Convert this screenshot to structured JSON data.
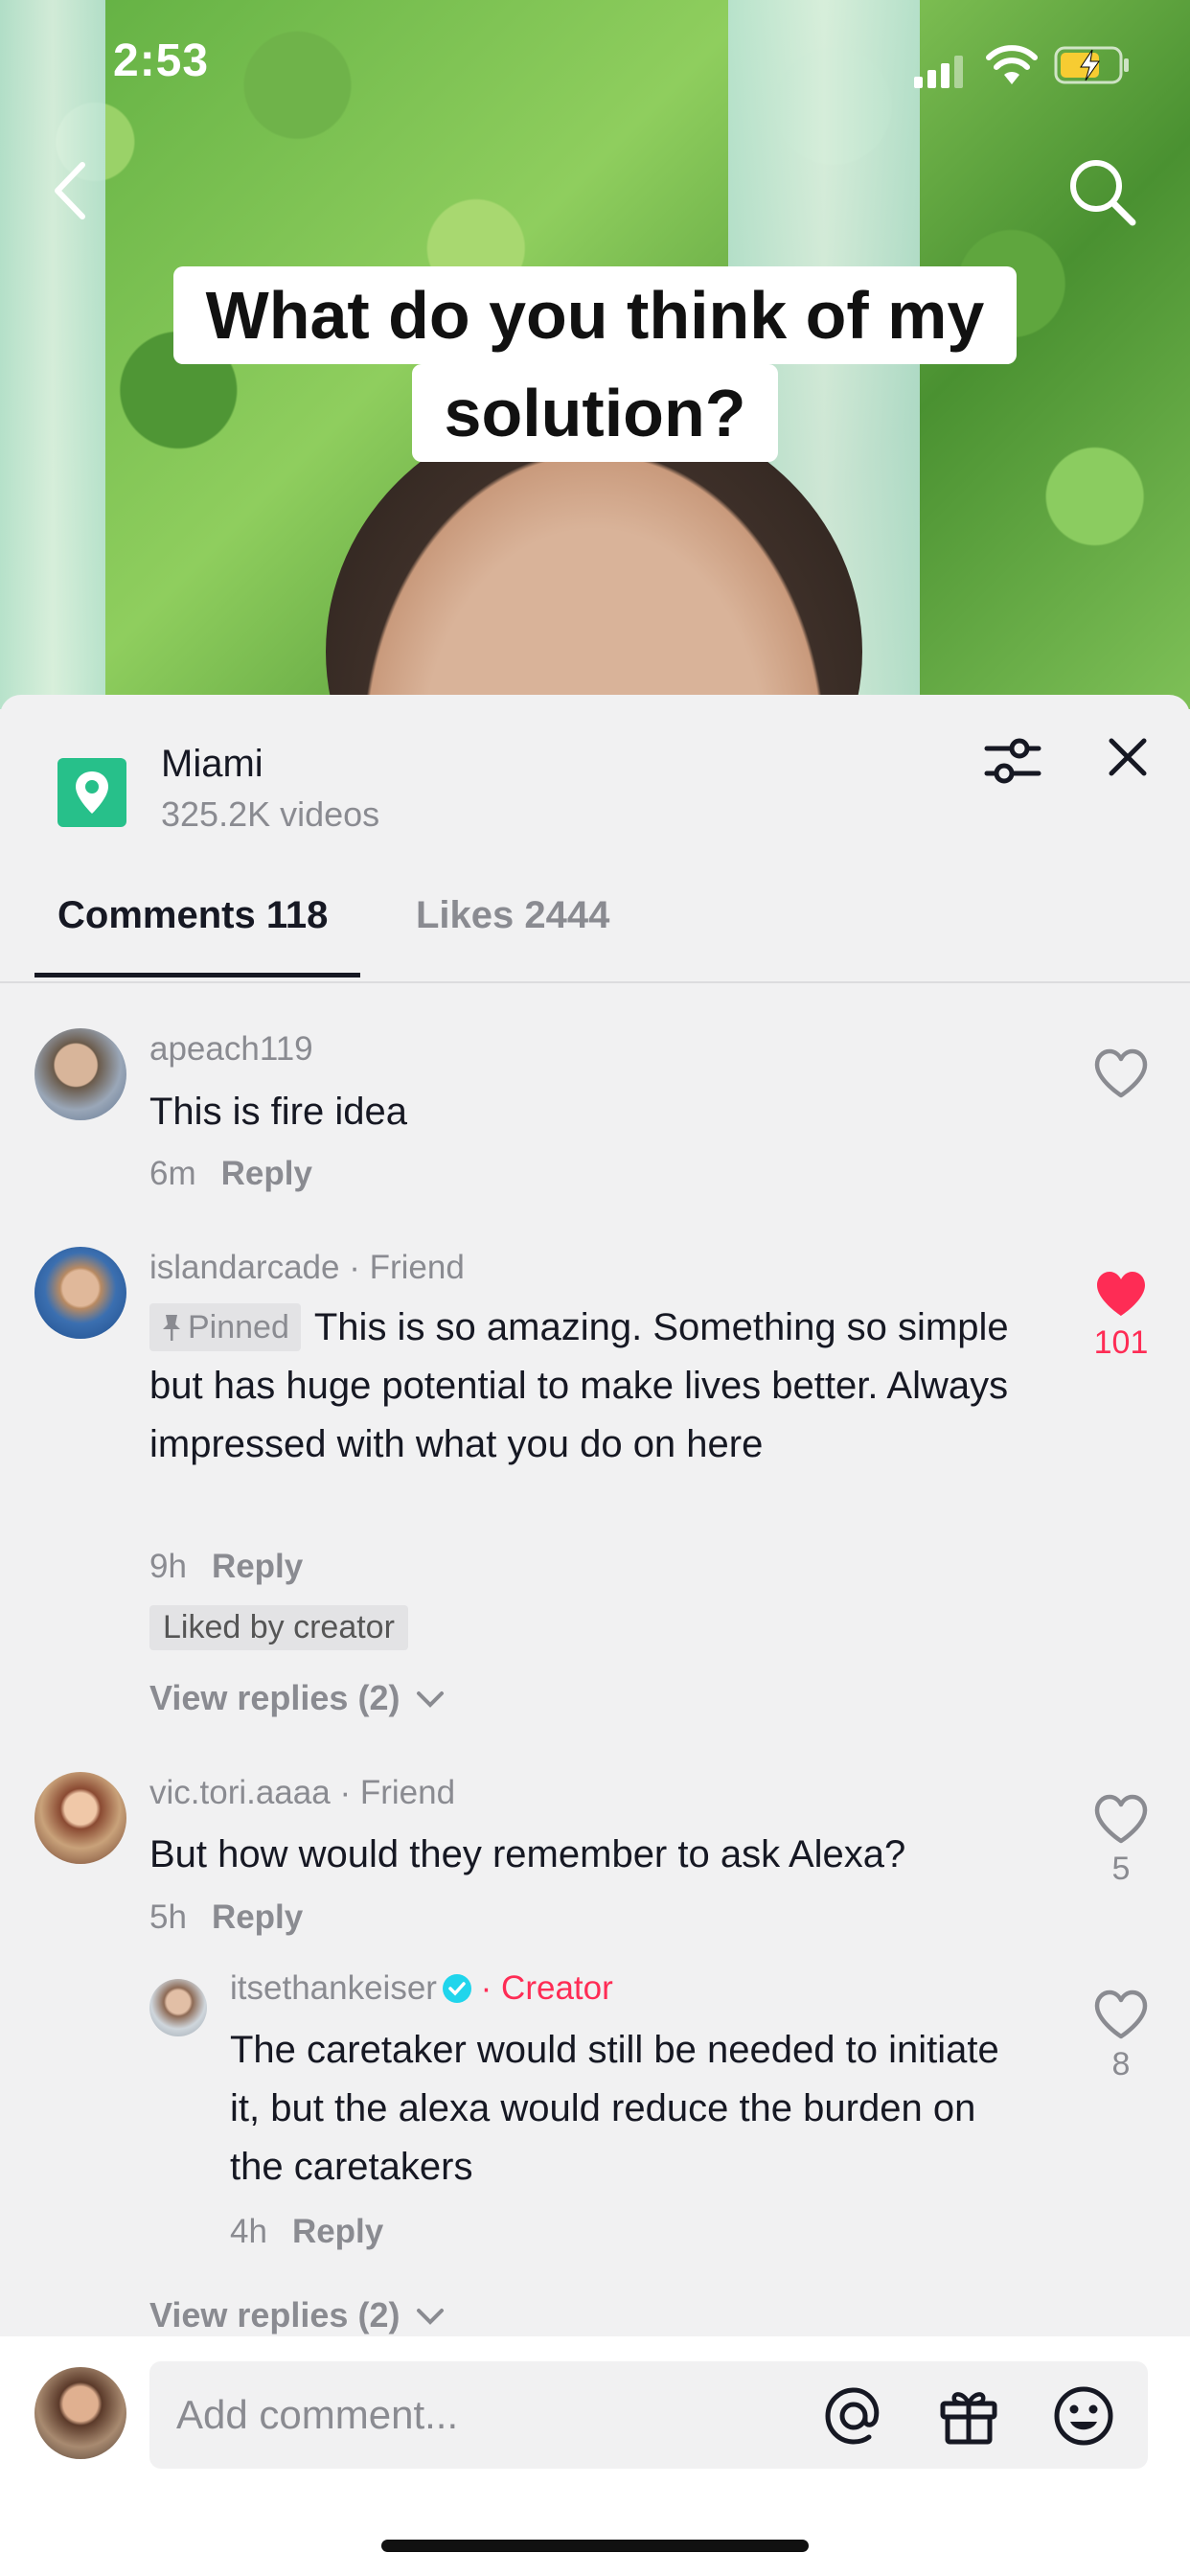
{
  "status_bar": {
    "time": "2:53"
  },
  "video": {
    "caption_line1": "What do you think of my",
    "caption_line2": "solution?"
  },
  "location": {
    "title": "Miami",
    "subtitle": "325.2K videos"
  },
  "tabs": {
    "comments": "Comments 118",
    "likes": "Likes 2444"
  },
  "comments": [
    {
      "username": "apeach119",
      "text": "This is fire idea",
      "time": "6m",
      "reply_label": "Reply"
    },
    {
      "username": "islandarcade",
      "tag": " · Friend",
      "pinned_label": "Pinned",
      "text": "This is so amazing. Something so simple but has huge potential to make lives better. Always impressed with what you do on here",
      "time": "9h",
      "reply_label": "Reply",
      "likes": "101",
      "liked_badge": "Liked by creator",
      "view_replies": "View replies (2)"
    },
    {
      "username": "vic.tori.aaaa",
      "tag": " · Friend",
      "text": "But how would they remember to ask Alexa?",
      "time": "5h",
      "reply_label": "Reply",
      "likes": "5"
    },
    {
      "username": "itsethankeiser",
      "tag": " · Creator",
      "text": "The caretaker would still be needed to initiate it, but the alexa would reduce the burden on the caretakers",
      "time": "4h",
      "reply_label": "Reply",
      "likes": "8",
      "view_replies": "View replies (2)"
    }
  ],
  "input": {
    "placeholder": "Add comment..."
  },
  "colors": {
    "accent": "#fe2c55",
    "location_icon": "#27c08a",
    "verified": "#20d5ec"
  }
}
